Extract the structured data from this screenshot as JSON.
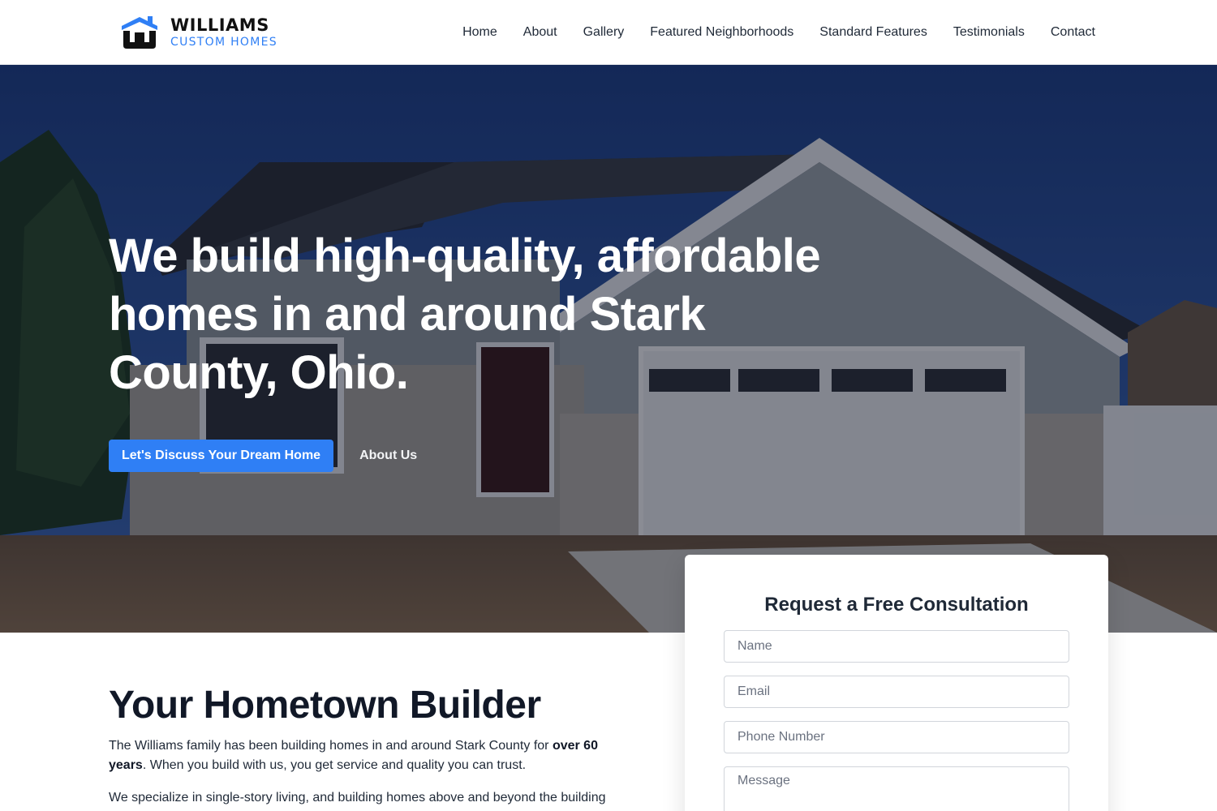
{
  "brand": {
    "name_line1": "WILLIAMS",
    "name_line2": "CUSTOM HOMES",
    "logo_icon": "house-w-icon",
    "colors": {
      "accent": "#2f7ff5",
      "dark": "#111111"
    }
  },
  "nav": {
    "items": [
      {
        "label": "Home"
      },
      {
        "label": "About"
      },
      {
        "label": "Gallery"
      },
      {
        "label": "Featured Neighborhoods"
      },
      {
        "label": "Standard Features"
      },
      {
        "label": "Testimonials"
      },
      {
        "label": "Contact"
      }
    ]
  },
  "hero": {
    "title": "We build high-quality, affordable homes in and around Stark County, Ohio.",
    "primary_cta": "Let's Discuss Your Dream Home",
    "secondary_cta": "About Us",
    "background": "house-photo"
  },
  "consultation": {
    "title": "Request a Free Consultation",
    "name_placeholder": "Name",
    "email_placeholder": "Email",
    "phone_placeholder": "Phone Number",
    "message_placeholder": "Message"
  },
  "about": {
    "title": "Your Hometown Builder",
    "p1_before": "The Williams family has been building homes in and around Stark County for ",
    "p1_bold": "over 60 years",
    "p1_after": ". When you build with us, you get service and quality you can trust.",
    "p2": "We specialize in single-story living, and building homes above and beyond the building"
  }
}
